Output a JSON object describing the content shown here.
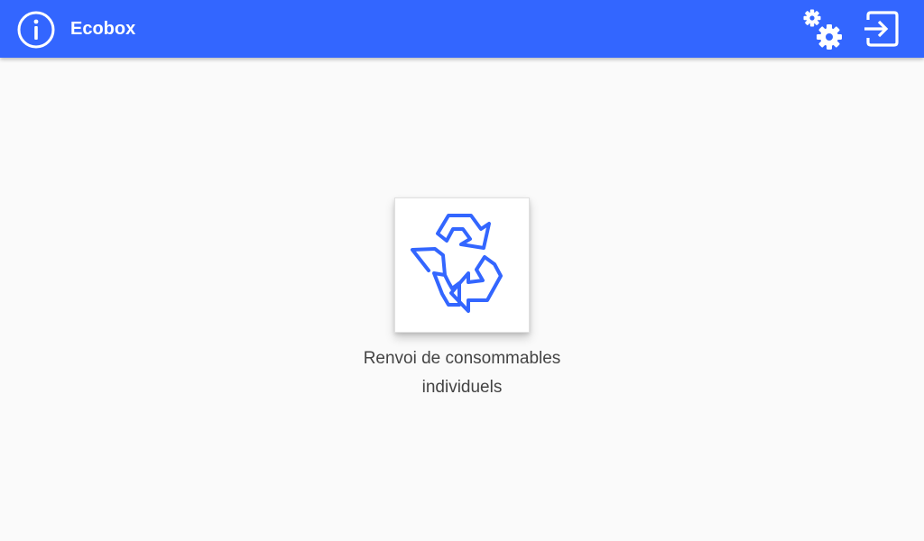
{
  "app_bar": {
    "title": "Ecobox",
    "background_color": "#3366ff",
    "info_icon": "info-icon",
    "settings_icon": "gears-icon",
    "logout_icon": "logout-icon"
  },
  "main": {
    "tiles": [
      {
        "label": "Renvoi de consommables individuels",
        "icon": "recycle-icon",
        "icon_color": "#3366ff"
      }
    ]
  }
}
